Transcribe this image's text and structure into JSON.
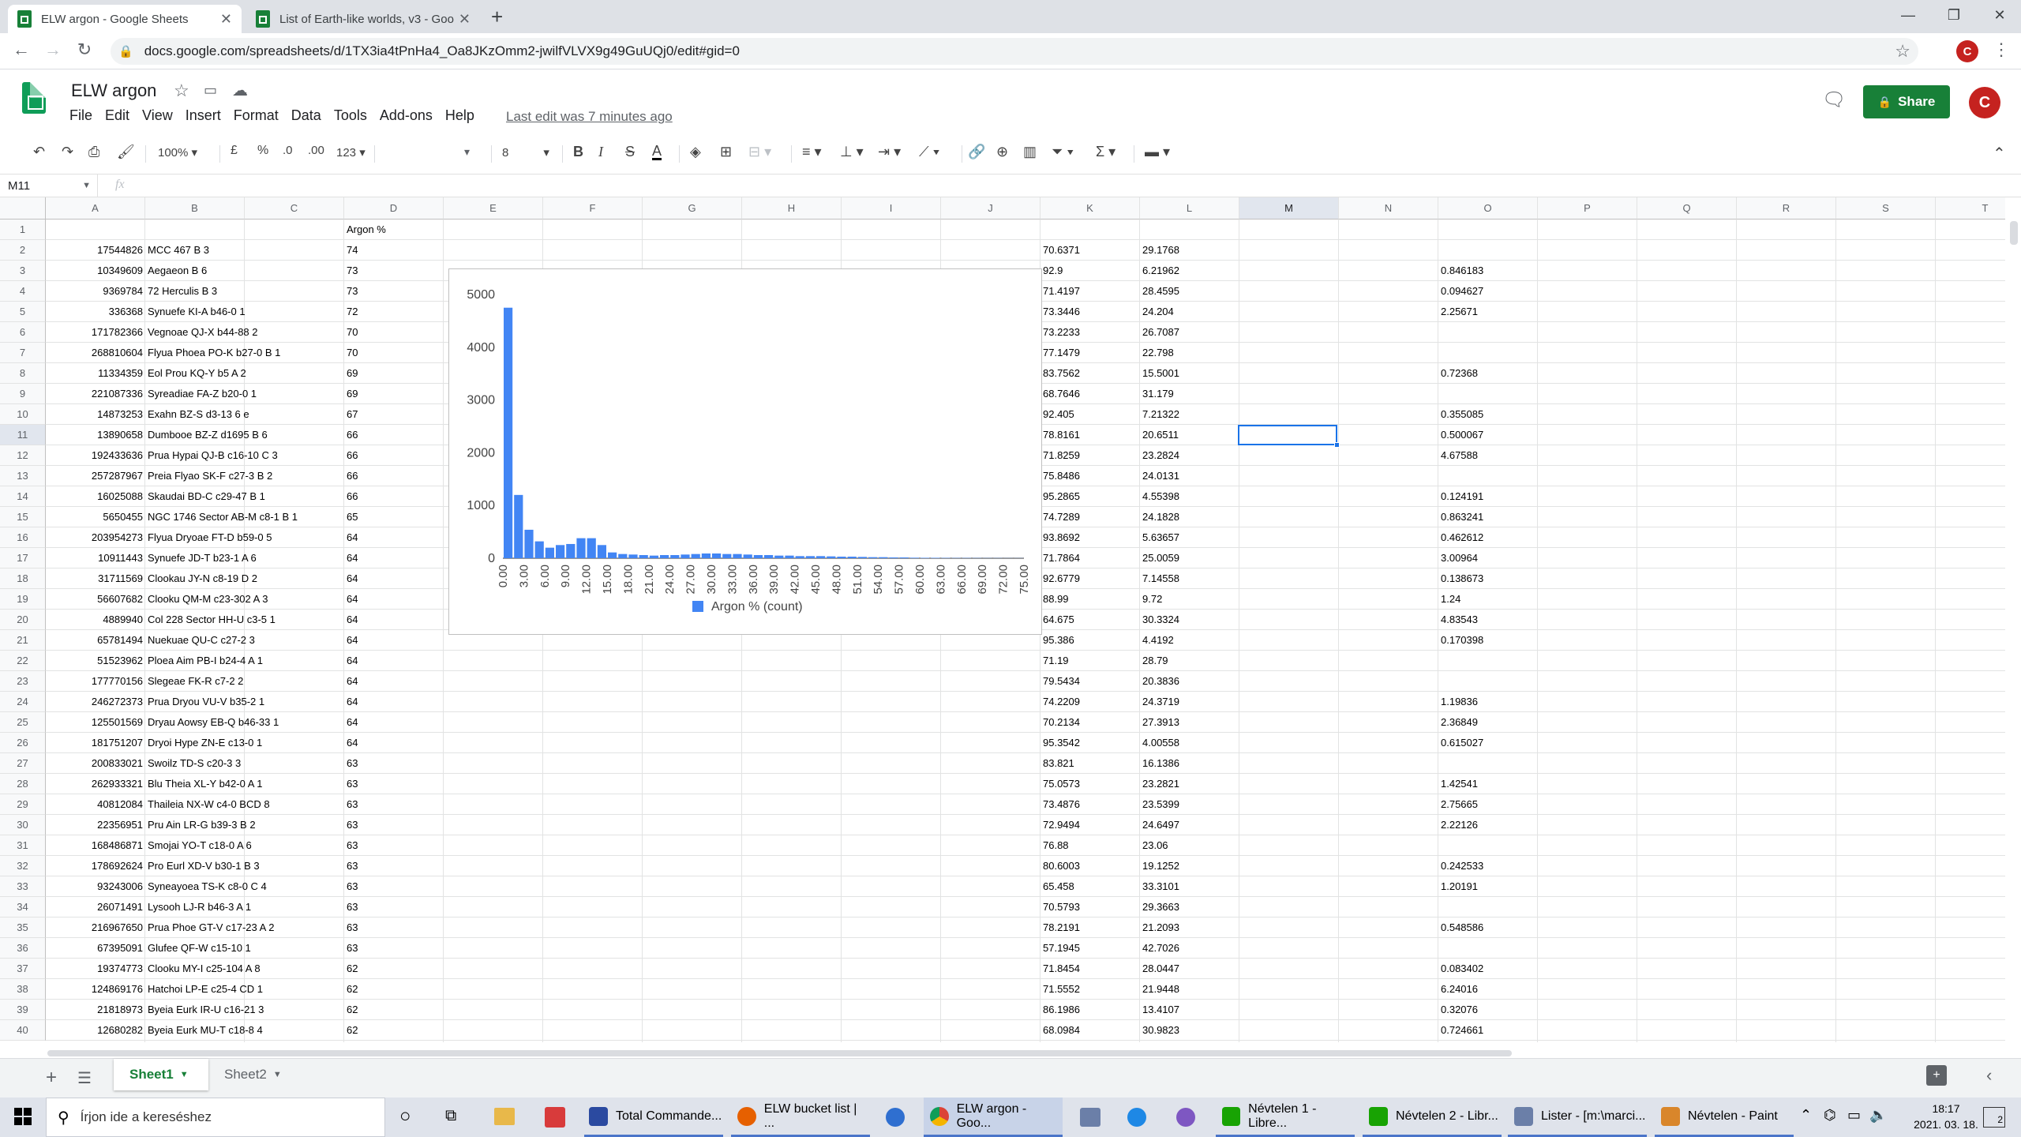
{
  "browser": {
    "tabs": [
      {
        "title": "ELW argon - Google Sheets",
        "active": true
      },
      {
        "title": "List of Earth-like worlds, v3 - Goo",
        "active": false
      }
    ],
    "new_tab": "+",
    "url": "docs.google.com/spreadsheets/d/1TX3ia4tPnHa4_Oa8JKzOmm2-jwilfVLVX9g49GuUQj0/edit#gid=0",
    "avatar": "C"
  },
  "docs": {
    "title": "ELW argon",
    "menu": [
      "File",
      "Edit",
      "View",
      "Insert",
      "Format",
      "Data",
      "Tools",
      "Add-ons",
      "Help"
    ],
    "last_edit": "Last edit was 7 minutes ago",
    "share": "Share",
    "avatar": "C"
  },
  "toolbar": {
    "zoom": "100%",
    "currency": "£",
    "percent": "%",
    "dec_less": ".0",
    "dec_more": ".00",
    "format": "123",
    "font_size": "8",
    "bold": "B",
    "italic": "I",
    "strike": "S",
    "text_color": "A"
  },
  "formula_bar": {
    "name_box": "M11",
    "fx": "fx",
    "value": ""
  },
  "columns": [
    "A",
    "B",
    "C",
    "D",
    "E",
    "F",
    "G",
    "H",
    "I",
    "J",
    "K",
    "L",
    "M",
    "N",
    "O",
    "P",
    "Q",
    "R",
    "S",
    "T"
  ],
  "selected_column": "M",
  "selected_row": 11,
  "rows": [
    {
      "n": 1,
      "A": "",
      "B": "",
      "D": "Argon %",
      "K": "",
      "L": "",
      "O": ""
    },
    {
      "n": 2,
      "A": "17544826",
      "B": "MCC 467 B 3",
      "D": "74",
      "K": "70.6371",
      "L": "29.1768",
      "O": ""
    },
    {
      "n": 3,
      "A": "10349609",
      "B": "Aegaeon B 6",
      "D": "73",
      "K": "92.9",
      "L": "6.21962",
      "O": "0.846183"
    },
    {
      "n": 4,
      "A": "9369784",
      "B": "72 Herculis B 3",
      "D": "73",
      "K": "71.4197",
      "L": "28.4595",
      "O": "0.094627"
    },
    {
      "n": 5,
      "A": "336368",
      "B": "Synuefe KI-A b46-0 1",
      "D": "72",
      "K": "73.3446",
      "L": "24.204",
      "O": "2.25671"
    },
    {
      "n": 6,
      "A": "171782366",
      "B": "Vegnoae QJ-X b44-88 2",
      "D": "70",
      "K": "73.2233",
      "L": "26.7087",
      "O": ""
    },
    {
      "n": 7,
      "A": "268810604",
      "B": "Flyua Phoea PO-K b27-0 B 1",
      "D": "70",
      "K": "77.1479",
      "L": "22.798",
      "O": ""
    },
    {
      "n": 8,
      "A": "11334359",
      "B": "Eol Prou KQ-Y b5 A 2",
      "D": "69",
      "K": "83.7562",
      "L": "15.5001",
      "O": "0.72368"
    },
    {
      "n": 9,
      "A": "221087336",
      "B": "Syreadiae FA-Z b20-0 1",
      "D": "69",
      "K": "68.7646",
      "L": "31.179",
      "O": ""
    },
    {
      "n": 10,
      "A": "14873253",
      "B": "Exahn BZ-S d3-13 6 e",
      "D": "67",
      "K": "92.405",
      "L": "7.21322",
      "O": "0.355085"
    },
    {
      "n": 11,
      "A": "13890658",
      "B": "Dumbooe BZ-Z d1695 B 6",
      "D": "66",
      "K": "78.8161",
      "L": "20.6511",
      "O": "0.500067"
    },
    {
      "n": 12,
      "A": "192433636",
      "B": "Prua Hypai QJ-B c16-10 C 3",
      "D": "66",
      "K": "71.8259",
      "L": "23.2824",
      "O": "4.67588"
    },
    {
      "n": 13,
      "A": "257287967",
      "B": "Preia Flyao SK-F c27-3 B 2",
      "D": "66",
      "K": "75.8486",
      "L": "24.0131",
      "O": ""
    },
    {
      "n": 14,
      "A": "16025088",
      "B": "Skaudai BD-C c29-47 B 1",
      "D": "66",
      "K": "95.2865",
      "L": "4.55398",
      "O": "0.124191"
    },
    {
      "n": 15,
      "A": "5650455",
      "B": "NGC 1746 Sector AB-M c8-1 B 1",
      "D": "65",
      "K": "74.7289",
      "L": "24.1828",
      "O": "0.863241"
    },
    {
      "n": 16,
      "A": "203954273",
      "B": "Flyua Dryoae FT-D b59-0 5",
      "D": "64",
      "K": "93.8692",
      "L": "5.63657",
      "O": "0.462612"
    },
    {
      "n": 17,
      "A": "10911443",
      "B": "Synuefe JD-T b23-1 A 6",
      "D": "64",
      "K": "71.7864",
      "L": "25.0059",
      "O": "3.00964"
    },
    {
      "n": 18,
      "A": "31711569",
      "B": "Clookau JY-N c8-19 D 2",
      "D": "64",
      "K": "92.6779",
      "L": "7.14558",
      "O": "0.138673"
    },
    {
      "n": 19,
      "A": "56607682",
      "B": "Clooku QM-M c23-302 A 3",
      "D": "64",
      "K": "88.99",
      "L": "9.72",
      "O": "1.24"
    },
    {
      "n": 20,
      "A": "4889940",
      "B": "Col 228 Sector HH-U c3-5 1",
      "D": "64",
      "K": "64.675",
      "L": "30.3324",
      "O": "4.83543"
    },
    {
      "n": 21,
      "A": "65781494",
      "B": "Nuekuae QU-C c27-2 3",
      "D": "64",
      "K": "95.386",
      "L": "4.4192",
      "O": "0.170398"
    },
    {
      "n": 22,
      "A": "51523962",
      "B": "Ploea Aim PB-I b24-4 A 1",
      "D": "64",
      "K": "71.19",
      "L": "28.79",
      "O": ""
    },
    {
      "n": 23,
      "A": "177770156",
      "B": "Slegeae FK-R c7-2 2",
      "D": "64",
      "K": "79.5434",
      "L": "20.3836",
      "O": ""
    },
    {
      "n": 24,
      "A": "246272373",
      "B": "Prua Dryou VU-V b35-2 1",
      "D": "64",
      "K": "74.2209",
      "L": "24.3719",
      "O": "1.19836"
    },
    {
      "n": 25,
      "A": "125501569",
      "B": "Dryau Aowsy EB-Q b46-33 1",
      "D": "64",
      "K": "70.2134",
      "L": "27.3913",
      "O": "2.36849"
    },
    {
      "n": 26,
      "A": "181751207",
      "B": "Dryoi Hype ZN-E c13-0 1",
      "D": "64",
      "K": "95.3542",
      "L": "4.00558",
      "O": "0.615027"
    },
    {
      "n": 27,
      "A": "200833021",
      "B": "Swoilz TD-S c20-3 3",
      "D": "63",
      "K": "83.821",
      "L": "16.1386",
      "O": ""
    },
    {
      "n": 28,
      "A": "262933321",
      "B": "Blu Theia XL-Y b42-0 A 1",
      "D": "63",
      "K": "75.0573",
      "L": "23.2821",
      "O": "1.42541"
    },
    {
      "n": 29,
      "A": "40812084",
      "B": "Thaileia NX-W c4-0 BCD 8",
      "D": "63",
      "K": "73.4876",
      "L": "23.5399",
      "O": "2.75665"
    },
    {
      "n": 30,
      "A": "22356951",
      "B": "Pru Ain LR-G b39-3 B 2",
      "D": "63",
      "K": "72.9494",
      "L": "24.6497",
      "O": "2.22126"
    },
    {
      "n": 31,
      "A": "168486871",
      "B": "Smojai YO-T c18-0 A 6",
      "D": "63",
      "K": "76.88",
      "L": "23.06",
      "O": ""
    },
    {
      "n": 32,
      "A": "178692624",
      "B": "Pro Eurl XD-V b30-1 B 3",
      "D": "63",
      "K": "80.6003",
      "L": "19.1252",
      "O": "0.242533"
    },
    {
      "n": 33,
      "A": "93243006",
      "B": "Syneayoea TS-K c8-0 C 4",
      "D": "63",
      "K": "65.458",
      "L": "33.3101",
      "O": "1.20191"
    },
    {
      "n": 34,
      "A": "26071491",
      "B": "Lysooh LJ-R b46-3 A 1",
      "D": "63",
      "K": "70.5793",
      "L": "29.3663",
      "O": ""
    },
    {
      "n": 35,
      "A": "216967650",
      "B": "Prua Phoe GT-V c17-23 A 2",
      "D": "63",
      "K": "78.2191",
      "L": "21.2093",
      "O": "0.548586"
    },
    {
      "n": 36,
      "A": "67395091",
      "B": "Glufee QF-W c15-10 1",
      "D": "63",
      "K": "57.1945",
      "L": "42.7026",
      "O": ""
    },
    {
      "n": 37,
      "A": "19374773",
      "B": "Clooku MY-I c25-104 A 8",
      "D": "62",
      "K": "71.8454",
      "L": "28.0447",
      "O": "0.083402"
    },
    {
      "n": 38,
      "A": "124869176",
      "B": "Hatchoi LP-E c25-4 CD 1",
      "D": "62",
      "K": "71.5552",
      "L": "21.9448",
      "O": "6.24016"
    },
    {
      "n": 39,
      "A": "21818973",
      "B": "Byeia Eurk IR-U c16-21 3",
      "D": "62",
      "K": "86.1986",
      "L": "13.4107",
      "O": "0.32076"
    },
    {
      "n": 40,
      "A": "12680282",
      "B": "Byeia Eurk MU-T c18-8 4",
      "D": "62",
      "K": "68.0984",
      "L": "30.9823",
      "O": "0.724661"
    }
  ],
  "chart_data": {
    "type": "bar",
    "title": "",
    "xlabel": "",
    "ylabel": "",
    "ylim": [
      0,
      5000
    ],
    "y_ticks": [
      "0",
      "1000",
      "2000",
      "3000",
      "4000",
      "5000"
    ],
    "x_tick_labels": [
      "0.00",
      "3.00",
      "6.00",
      "9.00",
      "12.00",
      "15.00",
      "18.00",
      "21.00",
      "24.00",
      "27.00",
      "30.00",
      "33.00",
      "36.00",
      "39.00",
      "42.00",
      "45.00",
      "48.00",
      "51.00",
      "54.00",
      "57.00",
      "60.00",
      "63.00",
      "66.00",
      "69.00",
      "72.00",
      "75.00"
    ],
    "x_min": 0,
    "x_max": 75,
    "bin_width": 1.5,
    "series": [
      {
        "name": "Argon % (count)",
        "color": "#4285f4",
        "values": [
          4750,
          1200,
          540,
          320,
          200,
          250,
          270,
          380,
          380,
          250,
          110,
          80,
          70,
          60,
          50,
          60,
          60,
          70,
          80,
          90,
          90,
          80,
          80,
          70,
          60,
          60,
          50,
          50,
          40,
          40,
          40,
          35,
          30,
          30,
          25,
          20,
          20,
          15,
          15,
          10,
          8,
          8,
          6,
          5,
          5,
          4,
          3,
          3,
          2,
          2
        ]
      }
    ],
    "legend_position": "bottom",
    "grid": false
  },
  "sheets": {
    "tabs": [
      "Sheet1",
      "Sheet2"
    ],
    "active": "Sheet1"
  },
  "taskbar": {
    "search_placeholder": "Írjon ide a kereséshez",
    "items": [
      {
        "label": "Total Commande...",
        "color": "#2b4aa0"
      },
      {
        "label": "ELW bucket list | ...",
        "color": "#e66000"
      },
      {
        "label": "ELW argon - Goo...",
        "color": "#4285f4"
      },
      {
        "label": "Névtelen 1 - Libre...",
        "color": "#18a303"
      },
      {
        "label": "Névtelen 2 - Libr...",
        "color": "#18a303"
      },
      {
        "label": "Lister - [m:\\marci...",
        "color": "#6b7fa8"
      },
      {
        "label": "Névtelen - Paint",
        "color": "#d9862b"
      }
    ],
    "time": "18:17",
    "date": "2021. 03. 18.",
    "notifications": "2"
  }
}
